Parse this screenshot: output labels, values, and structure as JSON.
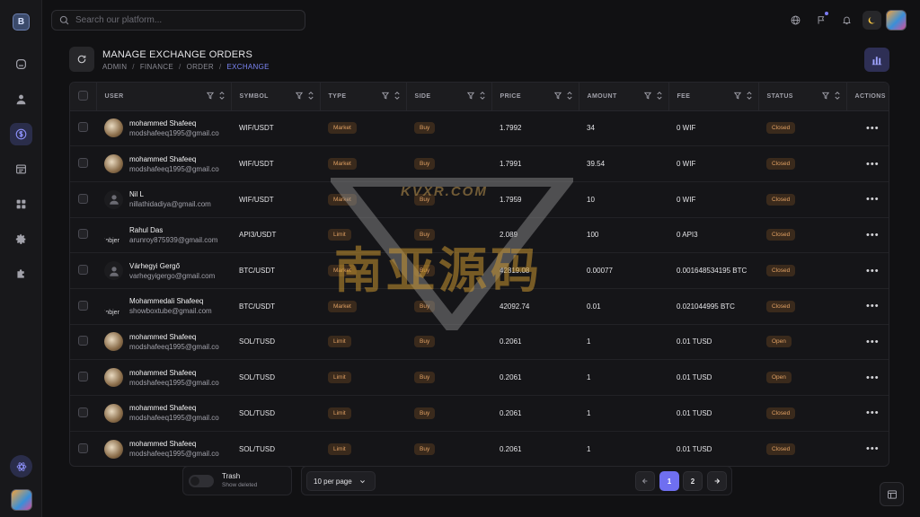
{
  "search": {
    "placeholder": "Search our platform..."
  },
  "sidebar": {
    "logo_letter": "B"
  },
  "page": {
    "title": "MANAGE EXCHANGE ORDERS",
    "breadcrumb": [
      "ADMIN",
      "FINANCE",
      "ORDER",
      "EXCHANGE"
    ]
  },
  "table": {
    "columns": [
      "USER",
      "SYMBOL",
      "TYPE",
      "SIDE",
      "PRICE",
      "AMOUNT",
      "FEE",
      "STATUS",
      "ACTIONS"
    ],
    "rows": [
      {
        "avatar": "photo",
        "name": "mohammed Shafeeq",
        "email": "modshafeeq1995@gmail.co",
        "symbol": "WIF/USDT",
        "type": "Market",
        "side": "Buy",
        "price": "1.7992",
        "amount": "34",
        "fee": "0 WIF",
        "status": "Closed"
      },
      {
        "avatar": "photo",
        "name": "mohammed Shafeeq",
        "email": "modshafeeq1995@gmail.co",
        "symbol": "WIF/USDT",
        "type": "Market",
        "side": "Buy",
        "price": "1.7991",
        "amount": "39.54",
        "fee": "0 WIF",
        "status": "Closed"
      },
      {
        "avatar": "placeholder",
        "name": "Nil L",
        "email": "nillathidadiya@gmail.com",
        "symbol": "WIF/USDT",
        "type": "Market",
        "side": "Buy",
        "price": "1.7959",
        "amount": "10",
        "fee": "0 WIF",
        "status": "Closed"
      },
      {
        "avatar": "broken",
        "broken_text": "'objer",
        "name": "Rahul Das",
        "email": "arunroy875939@gmail.com",
        "symbol": "API3/USDT",
        "type": "Limit",
        "side": "Buy",
        "price": "2.089",
        "amount": "100",
        "fee": "0 API3",
        "status": "Closed"
      },
      {
        "avatar": "placeholder",
        "name": "Várhegyi Gergő",
        "email": "varhegyigergo@gmail.com",
        "symbol": "BTC/USDT",
        "type": "Market",
        "side": "Buy",
        "price": "42819.08",
        "amount": "0.00077",
        "fee": "0.001648534195 BTC",
        "status": "Closed"
      },
      {
        "avatar": "broken",
        "broken_text": "'objer",
        "name": "Mohammedali Shafeeq",
        "email": "showboxtube@gmail.com",
        "symbol": "BTC/USDT",
        "type": "Market",
        "side": "Buy",
        "price": "42092.74",
        "amount": "0.01",
        "fee": "0.021044995 BTC",
        "status": "Closed"
      },
      {
        "avatar": "photo",
        "name": "mohammed Shafeeq",
        "email": "modshafeeq1995@gmail.co",
        "symbol": "SOL/TUSD",
        "type": "Limit",
        "side": "Buy",
        "price": "0.2061",
        "amount": "1",
        "fee": "0.01 TUSD",
        "status": "Open"
      },
      {
        "avatar": "photo",
        "name": "mohammed Shafeeq",
        "email": "modshafeeq1995@gmail.co",
        "symbol": "SOL/TUSD",
        "type": "Limit",
        "side": "Buy",
        "price": "0.2061",
        "amount": "1",
        "fee": "0.01 TUSD",
        "status": "Open"
      },
      {
        "avatar": "photo",
        "name": "mohammed Shafeeq",
        "email": "modshafeeq1995@gmail.co",
        "symbol": "SOL/TUSD",
        "type": "Limit",
        "side": "Buy",
        "price": "0.2061",
        "amount": "1",
        "fee": "0.01 TUSD",
        "status": "Closed"
      },
      {
        "avatar": "photo",
        "name": "mohammed Shafeeq",
        "email": "modshafeeq1995@gmail.co",
        "symbol": "SOL/TUSD",
        "type": "Limit",
        "side": "Buy",
        "price": "0.2061",
        "amount": "1",
        "fee": "0.01 TUSD",
        "status": "Closed"
      }
    ],
    "actions_glyph": "•••"
  },
  "watermark": {
    "top_text": "KVXR.COM",
    "main_text": "南亚源码"
  },
  "footer": {
    "trash_title": "Trash",
    "trash_sub": "Show deleted",
    "per_page": "10 per page",
    "pages": [
      "1",
      "2"
    ],
    "current_page": "1"
  },
  "colors": {
    "accent": "#6f6ff0",
    "badge_bg": "#3a2a1c",
    "badge_text": "#e0a063"
  }
}
